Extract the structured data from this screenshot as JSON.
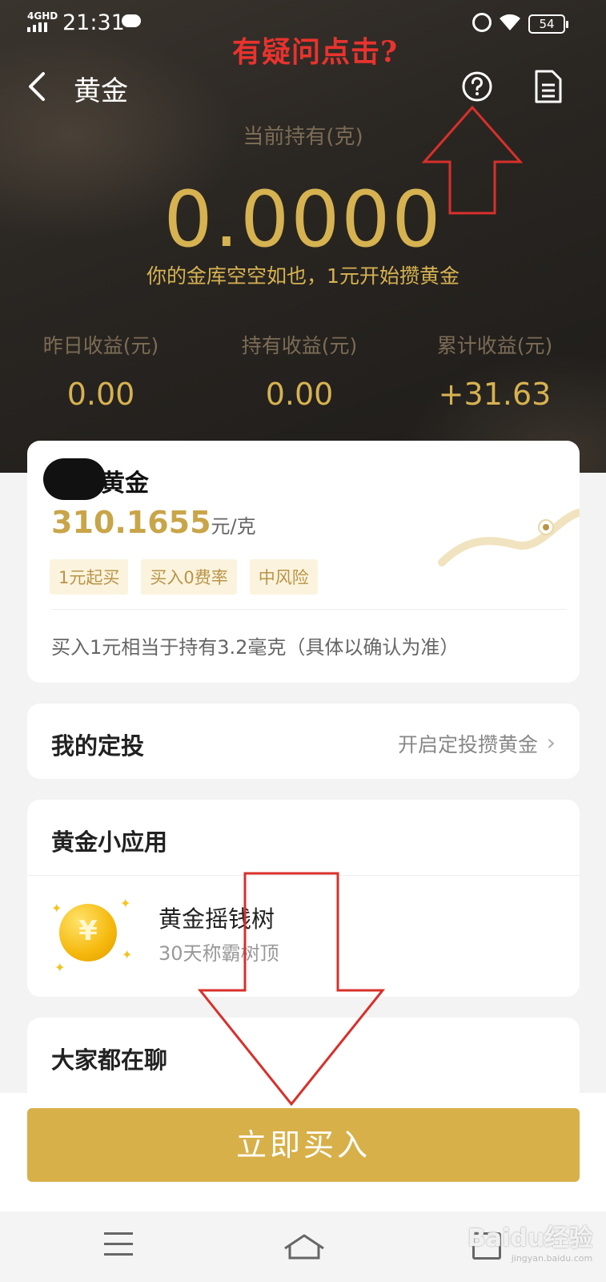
{
  "status_bar": {
    "network": "4GHD",
    "time": "21:31",
    "battery": "54"
  },
  "annotation": {
    "top_text": "有疑问点击?"
  },
  "header": {
    "title": "黄金"
  },
  "holding": {
    "label": "当前持有(克)",
    "value": "0.0000",
    "tip": "你的金库空空如也，1元开始攒黄金"
  },
  "stats": [
    {
      "label": "昨日收益(元)",
      "value": "0.00"
    },
    {
      "label": "持有收益(元)",
      "value": "0.00"
    },
    {
      "label": "累计收益(元)",
      "value": "+31.63"
    }
  ],
  "gold_card": {
    "name": "黄金",
    "price": "310.1655",
    "unit": "元/克",
    "tags": [
      "1元起买",
      "买入0费率",
      "中风险"
    ],
    "note": "买入1元相当于持有3.2毫克（具体以确认为准）"
  },
  "plan_card": {
    "title": "我的定投",
    "link": "开启定投攒黄金"
  },
  "apps_card": {
    "title": "黄金小应用",
    "app_name": "黄金摇钱树",
    "app_sub": "30天称霸树顶"
  },
  "chat_card": {
    "title": "大家都在聊"
  },
  "buy_button": {
    "label": "立即买入"
  },
  "watermark": {
    "text": "Baidu经验",
    "sub": "jingyan.baidu.com"
  },
  "colors": {
    "gold": "#d6b251",
    "button": "#d8b04a",
    "annotation_red": "#e8332e",
    "hero_bg": "#2a2622"
  }
}
